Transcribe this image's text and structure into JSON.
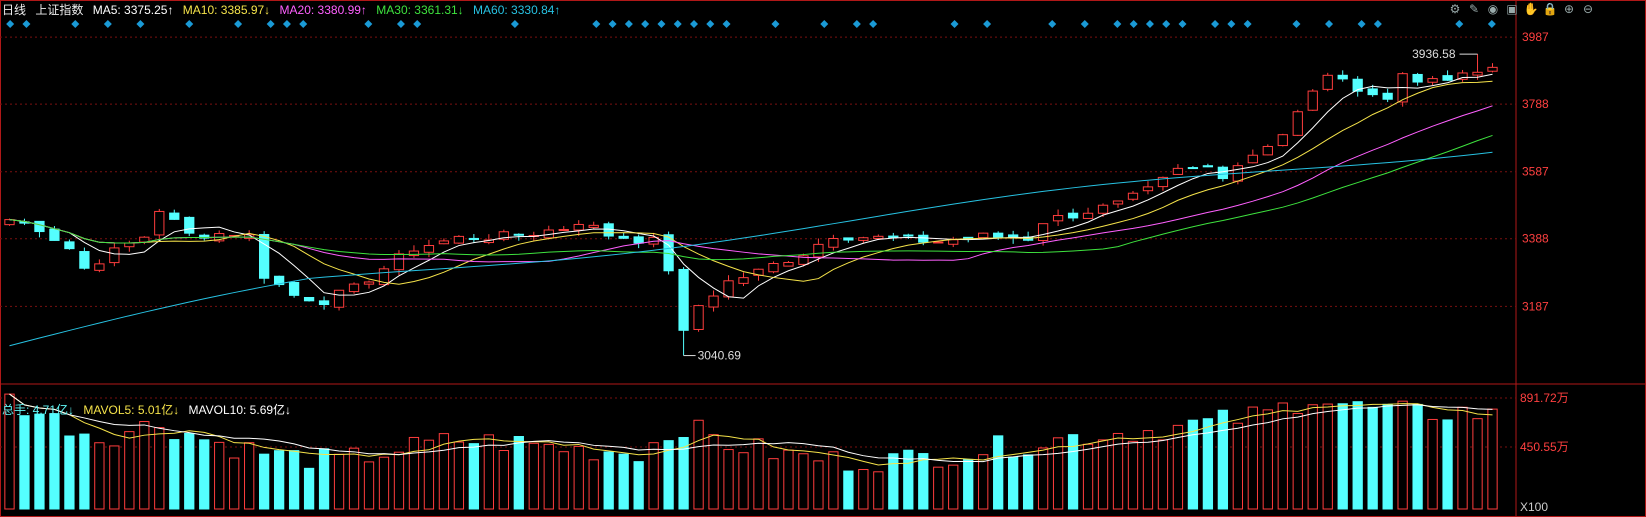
{
  "header": {
    "period": "日线",
    "symbol": "上证指数",
    "ma": [
      {
        "text": "MA5: 3375.25↑",
        "color": "#ffffff"
      },
      {
        "text": "MA10: 3385.97↓",
        "color": "#f5e34a"
      },
      {
        "text": "MA20: 3380.99↑",
        "color": "#ff60ff"
      },
      {
        "text": "MA30: 3361.31↓",
        "color": "#3ee23e"
      },
      {
        "text": "MA60: 3330.84↑",
        "color": "#27c2e2"
      }
    ]
  },
  "volume_header": {
    "items": [
      {
        "text": "总手: 4.71亿↓",
        "color": "#5ff5f5"
      },
      {
        "text": "MAVOL5: 5.01亿↓",
        "color": "#f5e34a"
      },
      {
        "text": "MAVOL10: 5.69亿↓",
        "color": "#ffffff"
      }
    ]
  },
  "toolbar": {
    "icons": [
      "settings-icon",
      "pen-icon",
      "eye-icon",
      "shop-icon",
      "hand-icon",
      "lock-icon",
      "zoom-in-icon",
      "zoom-out-icon"
    ],
    "glyphs": [
      "⚙",
      "✎",
      "◉",
      "▣",
      "✋",
      "🔒",
      "⊕",
      "⊖"
    ]
  },
  "price_axis": {
    "labels": [
      "3987",
      "3788",
      "3587",
      "3388",
      "3187"
    ],
    "values": [
      3987,
      3788,
      3587,
      3388,
      3187
    ]
  },
  "volume_axis": {
    "labels": [
      "891.72万",
      "450.55万",
      "X100"
    ]
  },
  "annotations": {
    "high": "3936.58",
    "low": "3040.69"
  },
  "colors": {
    "up": "#ff3d3d",
    "down": "#54ffff",
    "grid": "#7a1010",
    "frame": "#b01818",
    "axis_text": "#ff4040",
    "signal": "#1a9ad6"
  },
  "chart_data": {
    "type": "candlestick",
    "ylim": [
      2980,
      4020
    ],
    "price_ticks": [
      3987,
      3788,
      3587,
      3388,
      3187
    ],
    "volume_ticks": [
      "891.72万",
      "450.55万"
    ],
    "high_label": {
      "value": 3936.58,
      "index": 98
    },
    "low_label": {
      "value": 3040.69,
      "index": 45
    },
    "anchors": [
      [
        0,
        3445
      ],
      [
        2,
        3420
      ],
      [
        4,
        3360
      ],
      [
        5,
        3300
      ],
      [
        7,
        3350
      ],
      [
        9,
        3395
      ],
      [
        10,
        3475
      ],
      [
        12,
        3400
      ],
      [
        15,
        3405
      ],
      [
        16,
        3395
      ],
      [
        17,
        3280
      ],
      [
        19,
        3220
      ],
      [
        21,
        3205
      ],
      [
        23,
        3240
      ],
      [
        25,
        3300
      ],
      [
        27,
        3360
      ],
      [
        30,
        3390
      ],
      [
        33,
        3395
      ],
      [
        35,
        3405
      ],
      [
        37,
        3420
      ],
      [
        38,
        3440
      ],
      [
        40,
        3400
      ],
      [
        43,
        3380
      ],
      [
        44,
        3300
      ],
      [
        45,
        3105
      ],
      [
        46,
        3190
      ],
      [
        48,
        3260
      ],
      [
        50,
        3290
      ],
      [
        51,
        3310
      ],
      [
        53,
        3345
      ],
      [
        55,
        3400
      ],
      [
        58,
        3390
      ],
      [
        62,
        3380
      ],
      [
        65,
        3395
      ],
      [
        68,
        3390
      ],
      [
        69,
        3440
      ],
      [
        72,
        3470
      ],
      [
        74,
        3490
      ],
      [
        76,
        3530
      ],
      [
        78,
        3590
      ],
      [
        80,
        3600
      ],
      [
        81,
        3580
      ],
      [
        83,
        3640
      ],
      [
        85,
        3700
      ],
      [
        87,
        3820
      ],
      [
        88,
        3880
      ],
      [
        89,
        3850
      ],
      [
        90,
        3840
      ],
      [
        92,
        3800
      ],
      [
        93,
        3880
      ],
      [
        95,
        3850
      ],
      [
        96,
        3860
      ],
      [
        98,
        3880
      ],
      [
        99,
        3898
      ]
    ],
    "volume_anchors": [
      [
        0,
        0.92
      ],
      [
        3,
        0.75
      ],
      [
        6,
        0.6
      ],
      [
        10,
        0.72
      ],
      [
        14,
        0.55
      ],
      [
        18,
        0.45
      ],
      [
        22,
        0.4
      ],
      [
        26,
        0.5
      ],
      [
        30,
        0.58
      ],
      [
        34,
        0.55
      ],
      [
        38,
        0.5
      ],
      [
        42,
        0.48
      ],
      [
        45,
        0.7
      ],
      [
        48,
        0.55
      ],
      [
        52,
        0.45
      ],
      [
        56,
        0.4
      ],
      [
        60,
        0.42
      ],
      [
        64,
        0.48
      ],
      [
        68,
        0.55
      ],
      [
        72,
        0.62
      ],
      [
        76,
        0.66
      ],
      [
        80,
        0.72
      ],
      [
        84,
        0.8
      ],
      [
        87,
        0.95
      ],
      [
        90,
        0.85
      ],
      [
        94,
        0.8
      ],
      [
        97,
        0.82
      ],
      [
        99,
        0.78
      ]
    ],
    "signal_markers": [
      0,
      1,
      4,
      6,
      8,
      11,
      14,
      16,
      17,
      18,
      22,
      24,
      25,
      31,
      36,
      37,
      38,
      39,
      40,
      41,
      42,
      43,
      44,
      47,
      50,
      52,
      53,
      58,
      60,
      64,
      66,
      68,
      69,
      70,
      71,
      72,
      74,
      75,
      76,
      79,
      81,
      83,
      84,
      89,
      91
    ]
  }
}
